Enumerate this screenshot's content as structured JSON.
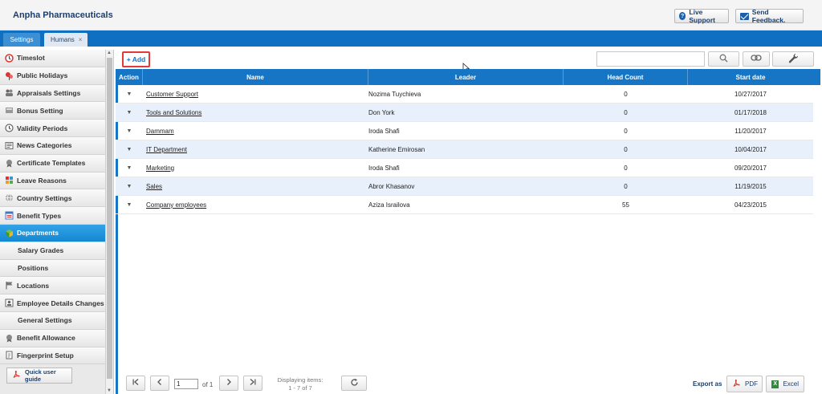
{
  "app": {
    "title": "Anpha Pharmaceuticals"
  },
  "header": {
    "live_support": "Live Support",
    "send_feedback": "Send Feedback."
  },
  "tabs": [
    {
      "label": "Settings"
    },
    {
      "label": "Humans",
      "close": "×"
    }
  ],
  "sidebar": {
    "items": [
      {
        "label": "Timeslot",
        "icon": "clock-icon"
      },
      {
        "label": "Public Holidays",
        "icon": "holiday-icon"
      },
      {
        "label": "Appraisals Settings",
        "icon": "users-icon"
      },
      {
        "label": "Bonus Setting",
        "icon": "bonus-icon"
      },
      {
        "label": "Validity Periods",
        "icon": "clock-icon"
      },
      {
        "label": "News Categories",
        "icon": "news-icon"
      },
      {
        "label": "Certificate Templates",
        "icon": "certificate-icon"
      },
      {
        "label": "Leave Reasons",
        "icon": "leave-icon"
      },
      {
        "label": "Country Settings",
        "icon": "globe-icon"
      },
      {
        "label": "Benefit Types",
        "icon": "benefit-icon"
      },
      {
        "label": "Departments",
        "icon": "cube-icon",
        "active": true
      },
      {
        "label": "Salary Grades",
        "icon": ""
      },
      {
        "label": "Positions",
        "icon": ""
      },
      {
        "label": "Locations",
        "icon": "flag-icon"
      },
      {
        "label": "Employee Details Changes",
        "icon": "employee-icon"
      },
      {
        "label": "General Settings",
        "icon": ""
      },
      {
        "label": "Benefit Allowance",
        "icon": "allowance-icon"
      },
      {
        "label": "Fingerprint Setup",
        "icon": "fingerprint-icon"
      }
    ],
    "guide_label": "Quick user guide"
  },
  "toolbar": {
    "add_label": "+ Add",
    "search_placeholder": ""
  },
  "grid": {
    "columns": {
      "action": "Action",
      "name": "Name",
      "leader": "Leader",
      "head_count": "Head Count",
      "start_date": "Start date"
    },
    "rows": [
      {
        "name": "Customer Support",
        "leader": "Nozima Tuychieva",
        "head_count": "0",
        "start_date": "10/27/2017"
      },
      {
        "name": "Tools and Solutions",
        "leader": "Don York",
        "head_count": "0",
        "start_date": "01/17/2018"
      },
      {
        "name": "Dammam",
        "leader": "Iroda Shafi",
        "head_count": "0",
        "start_date": "11/20/2017"
      },
      {
        "name": "IT Department",
        "leader": "Katherine Emirosan",
        "head_count": "0",
        "start_date": "10/04/2017"
      },
      {
        "name": "Marketing",
        "leader": "Iroda Shafi",
        "head_count": "0",
        "start_date": "09/20/2017"
      },
      {
        "name": "Sales",
        "leader": "Abror Khasanov",
        "head_count": "0",
        "start_date": "11/19/2015"
      },
      {
        "name": "Company employees",
        "leader": "Aziza Israilova",
        "head_count": "55",
        "start_date": "04/23/2015"
      }
    ]
  },
  "pager": {
    "page": "1",
    "of_label": "of",
    "total_pages": "1",
    "display_line1": "Displaying items:",
    "display_line2": "1 - 7 of 7",
    "export_label": "Export as",
    "pdf_label": "PDF",
    "excel_label": "Excel"
  }
}
